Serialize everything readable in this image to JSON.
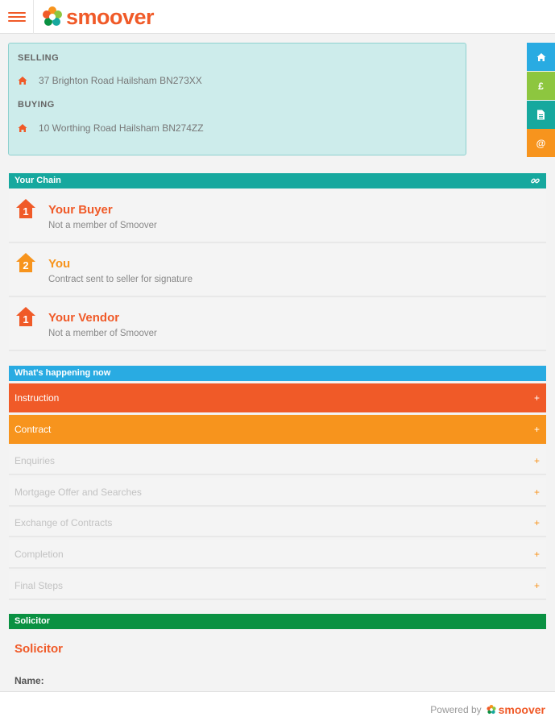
{
  "header": {
    "brand": "smoover",
    "menu_icon": "hamburger-icon"
  },
  "address": {
    "selling_label": "SELLING",
    "selling_address": "37 Brighton Road Hailsham BN273XX",
    "buying_label": "BUYING",
    "buying_address": "10 Worthing Road Hailsham BN274ZZ"
  },
  "side_buttons": [
    {
      "icon": "home-icon",
      "glyph": "",
      "color": "#29abe2"
    },
    {
      "icon": "pound-icon",
      "glyph": "£",
      "color": "#8dc63f"
    },
    {
      "icon": "document-icon",
      "glyph": "",
      "color": "#16a89e"
    },
    {
      "icon": "at-icon",
      "glyph": "@",
      "color": "#f7941d"
    }
  ],
  "chain": {
    "title": "Your Chain",
    "items": [
      {
        "number": "1",
        "name": "Your Buyer",
        "status": "Not a member of Smoover"
      },
      {
        "number": "2",
        "name": "You",
        "status": "Contract sent to seller for signature"
      },
      {
        "number": "1",
        "name": "Your Vendor",
        "status": "Not a member of Smoover"
      }
    ]
  },
  "happening": {
    "title": "What's happening now",
    "steps": [
      {
        "label": "Instruction",
        "toggle": "+"
      },
      {
        "label": "Contract",
        "toggle": "+"
      },
      {
        "label": "Enquiries",
        "toggle": "+"
      },
      {
        "label": "Mortgage Offer and Searches",
        "toggle": "+"
      },
      {
        "label": "Exchange of Contracts",
        "toggle": "+"
      },
      {
        "label": "Completion",
        "toggle": "+"
      },
      {
        "label": "Final Steps",
        "toggle": "+"
      }
    ]
  },
  "solicitor": {
    "section_title": "Solicitor",
    "heading": "Solicitor",
    "name_label": "Name:"
  },
  "footer": {
    "powered_by": "Powered by",
    "brand": "smoover"
  },
  "colors": {
    "brand_orange": "#f05a28",
    "accent_orange": "#f7941d",
    "teal": "#16a89e",
    "sky": "#29abe2",
    "green": "#0a9142"
  }
}
